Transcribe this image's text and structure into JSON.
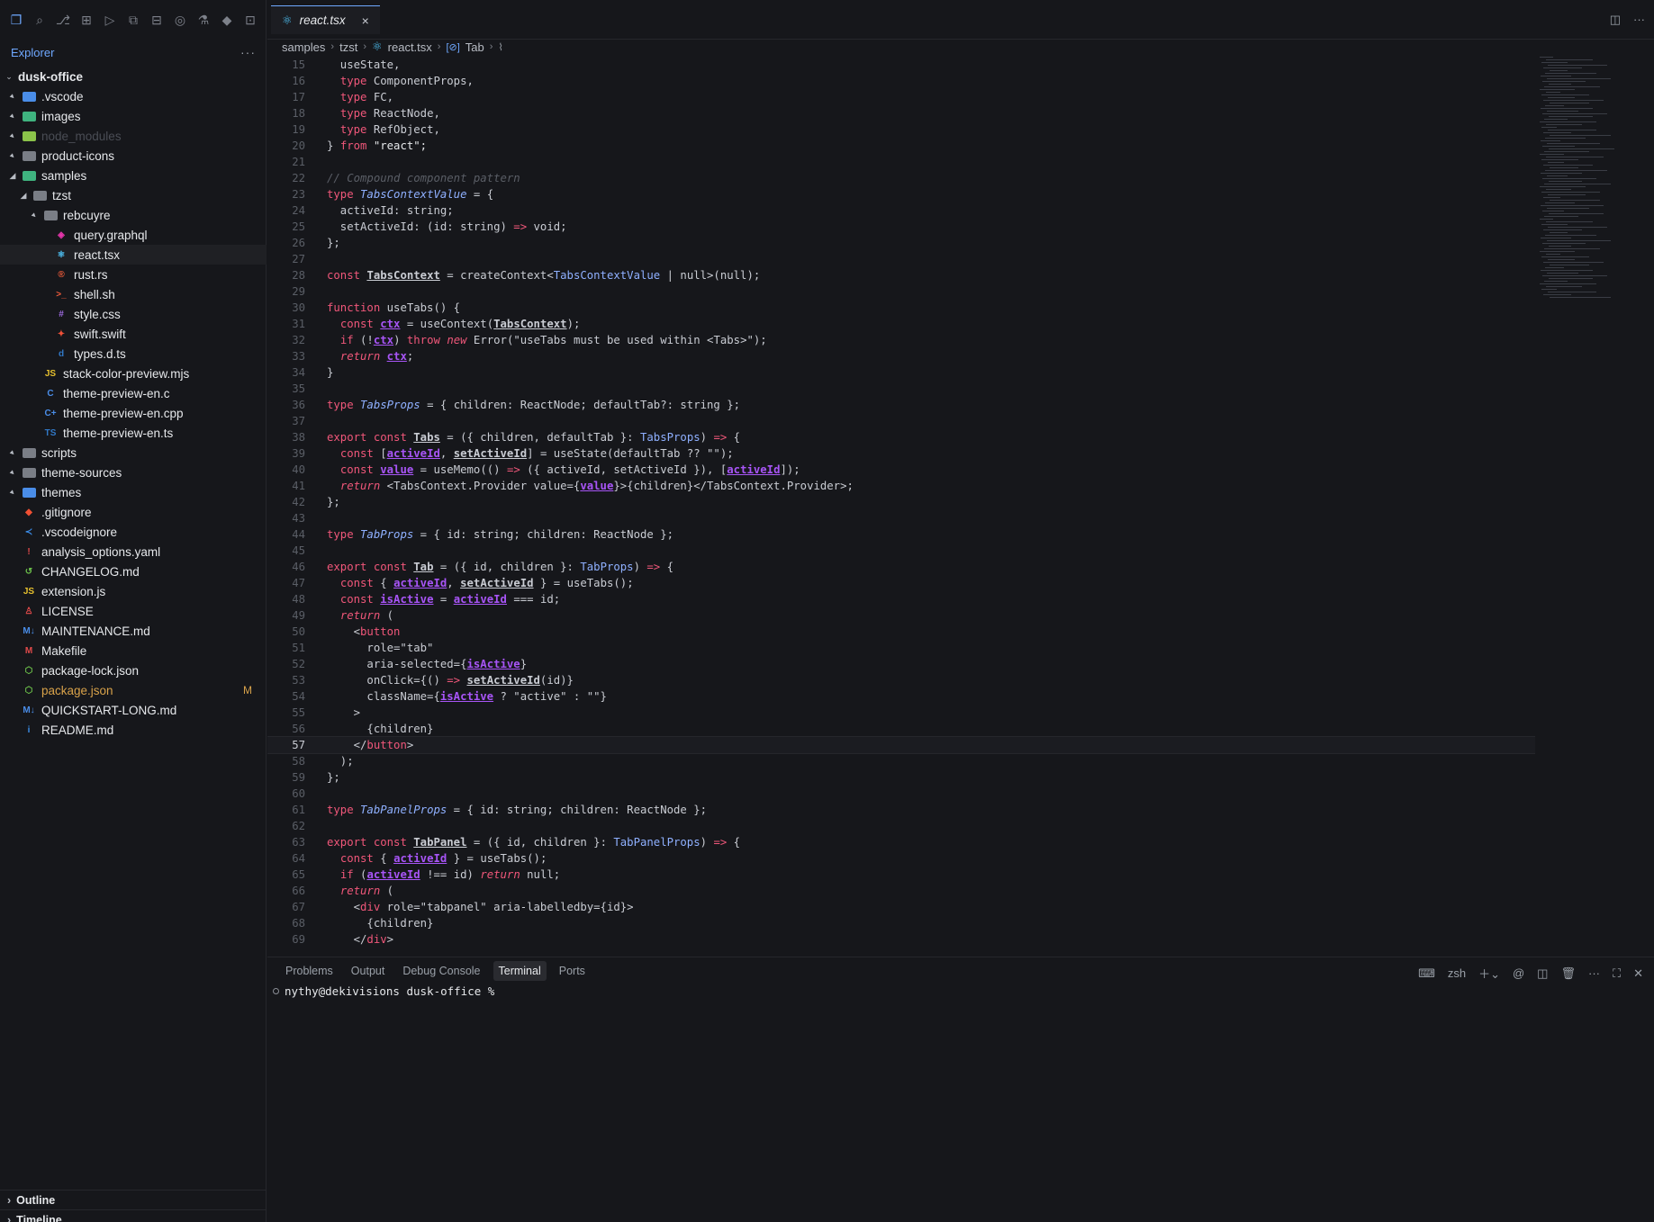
{
  "activity_icons": [
    "files-icon",
    "search-icon",
    "source-control-icon",
    "map-icon",
    "run-debug-icon",
    "remote-explorer-icon",
    "extensions-icon",
    "accounts-icon",
    "testing-icon",
    "docker-icon",
    "preview-icon"
  ],
  "explorer": {
    "title": "Explorer",
    "more": "···"
  },
  "tree": [
    {
      "label": "dusk-office",
      "depth": 0,
      "kind": "root",
      "twisty": "⌄"
    },
    {
      "label": ".vscode",
      "depth": 1,
      "kind": "folder",
      "color": "#4a8de8"
    },
    {
      "label": "images",
      "depth": 1,
      "kind": "folder",
      "color": "#3fb37f"
    },
    {
      "label": "node_modules",
      "depth": 1,
      "kind": "folder",
      "color": "#8bc34a",
      "dim": true
    },
    {
      "label": "product-icons",
      "depth": 1,
      "kind": "folder",
      "color": "#7a7e86"
    },
    {
      "label": "samples",
      "depth": 1,
      "kind": "folder",
      "color": "#3fb37f",
      "open": true
    },
    {
      "label": "tzst",
      "depth": 2,
      "kind": "folder",
      "color": "#7a7e86",
      "open": true
    },
    {
      "label": "rebcuyre",
      "depth": 3,
      "kind": "folder",
      "color": "#7a7e86"
    },
    {
      "label": "query.graphql",
      "depth": 4,
      "kind": "file",
      "glyph": "◈",
      "color": "#e535ab"
    },
    {
      "label": "react.tsx",
      "depth": 4,
      "kind": "file",
      "glyph": "⚛",
      "color": "#4fc3f7",
      "selected": true
    },
    {
      "label": "rust.rs",
      "depth": 4,
      "kind": "file",
      "glyph": "®",
      "color": "#ef5b3a"
    },
    {
      "label": "shell.sh",
      "depth": 4,
      "kind": "file",
      "glyph": ">_",
      "color": "#ef5b3a"
    },
    {
      "label": "style.css",
      "depth": 4,
      "kind": "file",
      "glyph": "#",
      "color": "#9c6ade"
    },
    {
      "label": "swift.swift",
      "depth": 4,
      "kind": "file",
      "glyph": "✦",
      "color": "#f05138"
    },
    {
      "label": "types.d.ts",
      "depth": 4,
      "kind": "file",
      "glyph": "d",
      "color": "#3178c6"
    },
    {
      "label": "stack-color-preview.mjs",
      "depth": 3,
      "kind": "file",
      "glyph": "JS",
      "color": "#e6c02e"
    },
    {
      "label": "theme-preview-en.c",
      "depth": 3,
      "kind": "file",
      "glyph": "C",
      "color": "#4a8de8"
    },
    {
      "label": "theme-preview-en.cpp",
      "depth": 3,
      "kind": "file",
      "glyph": "C+",
      "color": "#4a8de8"
    },
    {
      "label": "theme-preview-en.ts",
      "depth": 3,
      "kind": "file",
      "glyph": "TS",
      "color": "#3178c6"
    },
    {
      "label": "scripts",
      "depth": 1,
      "kind": "folder",
      "color": "#7a7e86"
    },
    {
      "label": "theme-sources",
      "depth": 1,
      "kind": "folder",
      "color": "#7a7e86"
    },
    {
      "label": "themes",
      "depth": 1,
      "kind": "folder",
      "color": "#4a8de8"
    },
    {
      "label": ".gitignore",
      "depth": 1,
      "kind": "file",
      "glyph": "◆",
      "color": "#f05033"
    },
    {
      "label": ".vscodeignore",
      "depth": 1,
      "kind": "file",
      "glyph": "≺",
      "color": "#3b8eea"
    },
    {
      "label": "analysis_options.yaml",
      "depth": 1,
      "kind": "file",
      "glyph": "!",
      "color": "#e04a4a"
    },
    {
      "label": "CHANGELOG.md",
      "depth": 1,
      "kind": "file",
      "glyph": "↺",
      "color": "#6cc04a"
    },
    {
      "label": "extension.js",
      "depth": 1,
      "kind": "file",
      "glyph": "JS",
      "color": "#e6c02e"
    },
    {
      "label": "LICENSE",
      "depth": 1,
      "kind": "file",
      "glyph": "♙",
      "color": "#e04a4a"
    },
    {
      "label": "MAINTENANCE.md",
      "depth": 1,
      "kind": "file",
      "glyph": "M↓",
      "color": "#4a8de8"
    },
    {
      "label": "Makefile",
      "depth": 1,
      "kind": "file",
      "glyph": "M",
      "color": "#e04a4a"
    },
    {
      "label": "package-lock.json",
      "depth": 1,
      "kind": "file",
      "glyph": "⬡",
      "color": "#6cc04a"
    },
    {
      "label": "package.json",
      "depth": 1,
      "kind": "file",
      "glyph": "⬡",
      "color": "#6cc04a",
      "badge": "M"
    },
    {
      "label": "QUICKSTART-LONG.md",
      "depth": 1,
      "kind": "file",
      "glyph": "M↓",
      "color": "#4a8de8"
    },
    {
      "label": "README.md",
      "depth": 1,
      "kind": "file",
      "glyph": "i",
      "color": "#3b8eea"
    }
  ],
  "outline": "Outline",
  "timeline": "Timeline",
  "tab": {
    "label": "react.tsx",
    "close": "×"
  },
  "breadcrumb": [
    "samples",
    "tzst",
    "react.tsx",
    "Tab"
  ],
  "colors": {
    "kw": "#f0577a",
    "str": "#e6e8eb",
    "type": "#8fb0ff",
    "fn": "#c9ccd3",
    "var": "#a855f7",
    "com": "#5a5e66",
    "tag": "#f0577a",
    "punc": "#c9ccd3"
  },
  "code": [
    {
      "n": "15",
      "t": [
        [
          "  useState,",
          "p"
        ]
      ]
    },
    {
      "n": "16",
      "t": [
        [
          "  ",
          "p"
        ],
        [
          "type",
          "k"
        ],
        [
          " ComponentProps,",
          "p"
        ]
      ]
    },
    {
      "n": "17",
      "t": [
        [
          "  ",
          "p"
        ],
        [
          "type",
          "k"
        ],
        [
          " FC,",
          "p"
        ]
      ]
    },
    {
      "n": "18",
      "t": [
        [
          "  ",
          "p"
        ],
        [
          "type",
          "k"
        ],
        [
          " ReactNode,",
          "p"
        ]
      ]
    },
    {
      "n": "19",
      "t": [
        [
          "  ",
          "p"
        ],
        [
          "type",
          "k"
        ],
        [
          " RefObject,",
          "p"
        ]
      ]
    },
    {
      "n": "20",
      "t": [
        [
          "} ",
          "p"
        ],
        [
          "from",
          "k"
        ],
        [
          " \"react\";",
          "s"
        ]
      ]
    },
    {
      "n": "21",
      "t": []
    },
    {
      "n": "22",
      "t": [
        [
          "// Compound component pattern",
          "c"
        ]
      ]
    },
    {
      "n": "23",
      "t": [
        [
          "type",
          "k"
        ],
        [
          " ",
          "p"
        ],
        [
          "TabsContextValue",
          "ti"
        ],
        [
          " = {",
          "p"
        ]
      ]
    },
    {
      "n": "24",
      "t": [
        [
          "  activeId: string;",
          "p"
        ]
      ]
    },
    {
      "n": "25",
      "t": [
        [
          "  setActiveId: (id: string) ",
          "p"
        ],
        [
          "=>",
          "k"
        ],
        [
          " void;",
          "p"
        ]
      ]
    },
    {
      "n": "26",
      "t": [
        [
          "};",
          "p"
        ]
      ]
    },
    {
      "n": "27",
      "t": []
    },
    {
      "n": "28",
      "t": [
        [
          "const",
          "k"
        ],
        [
          " ",
          "p"
        ],
        [
          "TabsContext",
          "vu"
        ],
        [
          " = createContext<",
          "p"
        ],
        [
          "TabsContextValue",
          "ty"
        ],
        [
          " | null>(null);",
          "p"
        ]
      ]
    },
    {
      "n": "29",
      "t": []
    },
    {
      "n": "30",
      "t": [
        [
          "function",
          "k"
        ],
        [
          " useTabs() {",
          "p"
        ]
      ]
    },
    {
      "n": "31",
      "t": [
        [
          "  ",
          "p"
        ],
        [
          "const",
          "k"
        ],
        [
          " ",
          "p"
        ],
        [
          "ctx",
          "v"
        ],
        [
          " = useContext(",
          "p"
        ],
        [
          "TabsContext",
          "vu"
        ],
        [
          ");",
          "p"
        ]
      ]
    },
    {
      "n": "32",
      "t": [
        [
          "  ",
          "p"
        ],
        [
          "if",
          "k"
        ],
        [
          " (!",
          "p"
        ],
        [
          "ctx",
          "v"
        ],
        [
          ") ",
          "p"
        ],
        [
          "throw",
          "k"
        ],
        [
          " ",
          "p"
        ],
        [
          "new",
          "ki"
        ],
        [
          " Error(\"useTabs must be used within <Tabs>\");",
          "p"
        ]
      ]
    },
    {
      "n": "33",
      "t": [
        [
          "  ",
          "p"
        ],
        [
          "return",
          "ki"
        ],
        [
          " ",
          "p"
        ],
        [
          "ctx",
          "v"
        ],
        [
          ";",
          "p"
        ]
      ]
    },
    {
      "n": "34",
      "t": [
        [
          "}",
          "p"
        ]
      ]
    },
    {
      "n": "35",
      "t": []
    },
    {
      "n": "36",
      "t": [
        [
          "type",
          "k"
        ],
        [
          " ",
          "p"
        ],
        [
          "TabsProps",
          "ti"
        ],
        [
          " = { children: ReactNode; defaultTab?: string };",
          "p"
        ]
      ]
    },
    {
      "n": "37",
      "t": []
    },
    {
      "n": "38",
      "t": [
        [
          "export",
          "k"
        ],
        [
          " ",
          "p"
        ],
        [
          "const",
          "k"
        ],
        [
          " ",
          "p"
        ],
        [
          "Tabs",
          "vu"
        ],
        [
          " = ({ children, defaultTab }: ",
          "p"
        ],
        [
          "TabsProps",
          "ty"
        ],
        [
          ") ",
          "p"
        ],
        [
          "=>",
          "k"
        ],
        [
          " {",
          "p"
        ]
      ]
    },
    {
      "n": "39",
      "t": [
        [
          "  ",
          "p"
        ],
        [
          "const",
          "k"
        ],
        [
          " [",
          "p"
        ],
        [
          "activeId",
          "v"
        ],
        [
          ", ",
          "p"
        ],
        [
          "setActiveId",
          "vu"
        ],
        [
          "] = useState(defaultTab ?? \"\");",
          "p"
        ]
      ]
    },
    {
      "n": "40",
      "t": [
        [
          "  ",
          "p"
        ],
        [
          "const",
          "k"
        ],
        [
          " ",
          "p"
        ],
        [
          "value",
          "v"
        ],
        [
          " = useMemo(() ",
          "p"
        ],
        [
          "=>",
          "k"
        ],
        [
          " ({ activeId, setActiveId }), [",
          "p"
        ],
        [
          "activeId",
          "v"
        ],
        [
          "]);",
          "p"
        ]
      ]
    },
    {
      "n": "41",
      "t": [
        [
          "  ",
          "p"
        ],
        [
          "return",
          "ki"
        ],
        [
          " <TabsContext.Provider value={",
          "p"
        ],
        [
          "value",
          "v"
        ],
        [
          "}>{children}</TabsContext.Provider>;",
          "p"
        ]
      ]
    },
    {
      "n": "42",
      "t": [
        [
          "};",
          "p"
        ]
      ]
    },
    {
      "n": "43",
      "t": []
    },
    {
      "n": "44",
      "t": [
        [
          "type",
          "k"
        ],
        [
          " ",
          "p"
        ],
        [
          "TabProps",
          "ti"
        ],
        [
          " = { id: string; children: ReactNode };",
          "p"
        ]
      ]
    },
    {
      "n": "45",
      "t": []
    },
    {
      "n": "46",
      "t": [
        [
          "export",
          "k"
        ],
        [
          " ",
          "p"
        ],
        [
          "const",
          "k"
        ],
        [
          " ",
          "p"
        ],
        [
          "Tab",
          "vu"
        ],
        [
          " = ({ id, children }: ",
          "p"
        ],
        [
          "TabProps",
          "ty"
        ],
        [
          ") ",
          "p"
        ],
        [
          "=>",
          "k"
        ],
        [
          " {",
          "p"
        ]
      ]
    },
    {
      "n": "47",
      "t": [
        [
          "  ",
          "p"
        ],
        [
          "const",
          "k"
        ],
        [
          " { ",
          "p"
        ],
        [
          "activeId",
          "v"
        ],
        [
          ", ",
          "p"
        ],
        [
          "setActiveId",
          "vu"
        ],
        [
          " } = useTabs();",
          "p"
        ]
      ]
    },
    {
      "n": "48",
      "t": [
        [
          "  ",
          "p"
        ],
        [
          "const",
          "k"
        ],
        [
          " ",
          "p"
        ],
        [
          "isActive",
          "v"
        ],
        [
          " = ",
          "p"
        ],
        [
          "activeId",
          "v"
        ],
        [
          " === id;",
          "p"
        ]
      ]
    },
    {
      "n": "49",
      "t": [
        [
          "  ",
          "p"
        ],
        [
          "return",
          "ki"
        ],
        [
          " (",
          "p"
        ]
      ]
    },
    {
      "n": "50",
      "t": [
        [
          "    <",
          "p"
        ],
        [
          "button",
          "tg"
        ]
      ]
    },
    {
      "n": "51",
      "t": [
        [
          "      role=\"tab\"",
          "p"
        ]
      ]
    },
    {
      "n": "52",
      "t": [
        [
          "      aria-selected={",
          "p"
        ],
        [
          "isActive",
          "v"
        ],
        [
          "}",
          "p"
        ]
      ]
    },
    {
      "n": "53",
      "t": [
        [
          "      onClick={() ",
          "p"
        ],
        [
          "=>",
          "k"
        ],
        [
          " ",
          "p"
        ],
        [
          "setActiveId",
          "vu"
        ],
        [
          "(id)}",
          "p"
        ]
      ]
    },
    {
      "n": "54",
      "t": [
        [
          "      className={",
          "p"
        ],
        [
          "isActive",
          "v"
        ],
        [
          " ? \"active\" : \"\"}",
          "p"
        ]
      ]
    },
    {
      "n": "55",
      "t": [
        [
          "    >",
          "p"
        ]
      ]
    },
    {
      "n": "56",
      "t": [
        [
          "      {children}",
          "p"
        ]
      ]
    },
    {
      "n": "57",
      "t": [
        [
          "    </",
          "p"
        ],
        [
          "button",
          "tg"
        ],
        [
          ">",
          "p"
        ]
      ],
      "cur": true
    },
    {
      "n": "58",
      "t": [
        [
          "  );",
          "p"
        ]
      ]
    },
    {
      "n": "59",
      "t": [
        [
          "};",
          "p"
        ]
      ]
    },
    {
      "n": "60",
      "t": []
    },
    {
      "n": "61",
      "t": [
        [
          "type",
          "k"
        ],
        [
          " ",
          "p"
        ],
        [
          "TabPanelProps",
          "ti"
        ],
        [
          " = { id: string; children: ReactNode };",
          "p"
        ]
      ]
    },
    {
      "n": "62",
      "t": []
    },
    {
      "n": "63",
      "t": [
        [
          "export",
          "k"
        ],
        [
          " ",
          "p"
        ],
        [
          "const",
          "k"
        ],
        [
          " ",
          "p"
        ],
        [
          "TabPanel",
          "vu"
        ],
        [
          " = ({ id, children }: ",
          "p"
        ],
        [
          "TabPanelProps",
          "ty"
        ],
        [
          ") ",
          "p"
        ],
        [
          "=>",
          "k"
        ],
        [
          " {",
          "p"
        ]
      ]
    },
    {
      "n": "64",
      "t": [
        [
          "  ",
          "p"
        ],
        [
          "const",
          "k"
        ],
        [
          " { ",
          "p"
        ],
        [
          "activeId",
          "v"
        ],
        [
          " } = useTabs();",
          "p"
        ]
      ]
    },
    {
      "n": "65",
      "t": [
        [
          "  ",
          "p"
        ],
        [
          "if",
          "k"
        ],
        [
          " (",
          "p"
        ],
        [
          "activeId",
          "v"
        ],
        [
          " !== id) ",
          "p"
        ],
        [
          "return",
          "ki"
        ],
        [
          " null;",
          "p"
        ]
      ]
    },
    {
      "n": "66",
      "t": [
        [
          "  ",
          "p"
        ],
        [
          "return",
          "ki"
        ],
        [
          " (",
          "p"
        ]
      ]
    },
    {
      "n": "67",
      "t": [
        [
          "    <",
          "p"
        ],
        [
          "div",
          "tg"
        ],
        [
          " role=\"tabpanel\" aria-labelledby={id}>",
          "p"
        ]
      ]
    },
    {
      "n": "68",
      "t": [
        [
          "      {children}",
          "p"
        ]
      ]
    },
    {
      "n": "69",
      "t": [
        [
          "    </",
          "p"
        ],
        [
          "div",
          "tg"
        ],
        [
          ">",
          "p"
        ]
      ]
    }
  ],
  "panel": {
    "tabs": [
      "Problems",
      "Output",
      "Debug Console",
      "Terminal",
      "Ports"
    ],
    "active_tab": "Terminal",
    "shell": "zsh",
    "prompt": "nythy@dekivisions dusk-office %"
  }
}
